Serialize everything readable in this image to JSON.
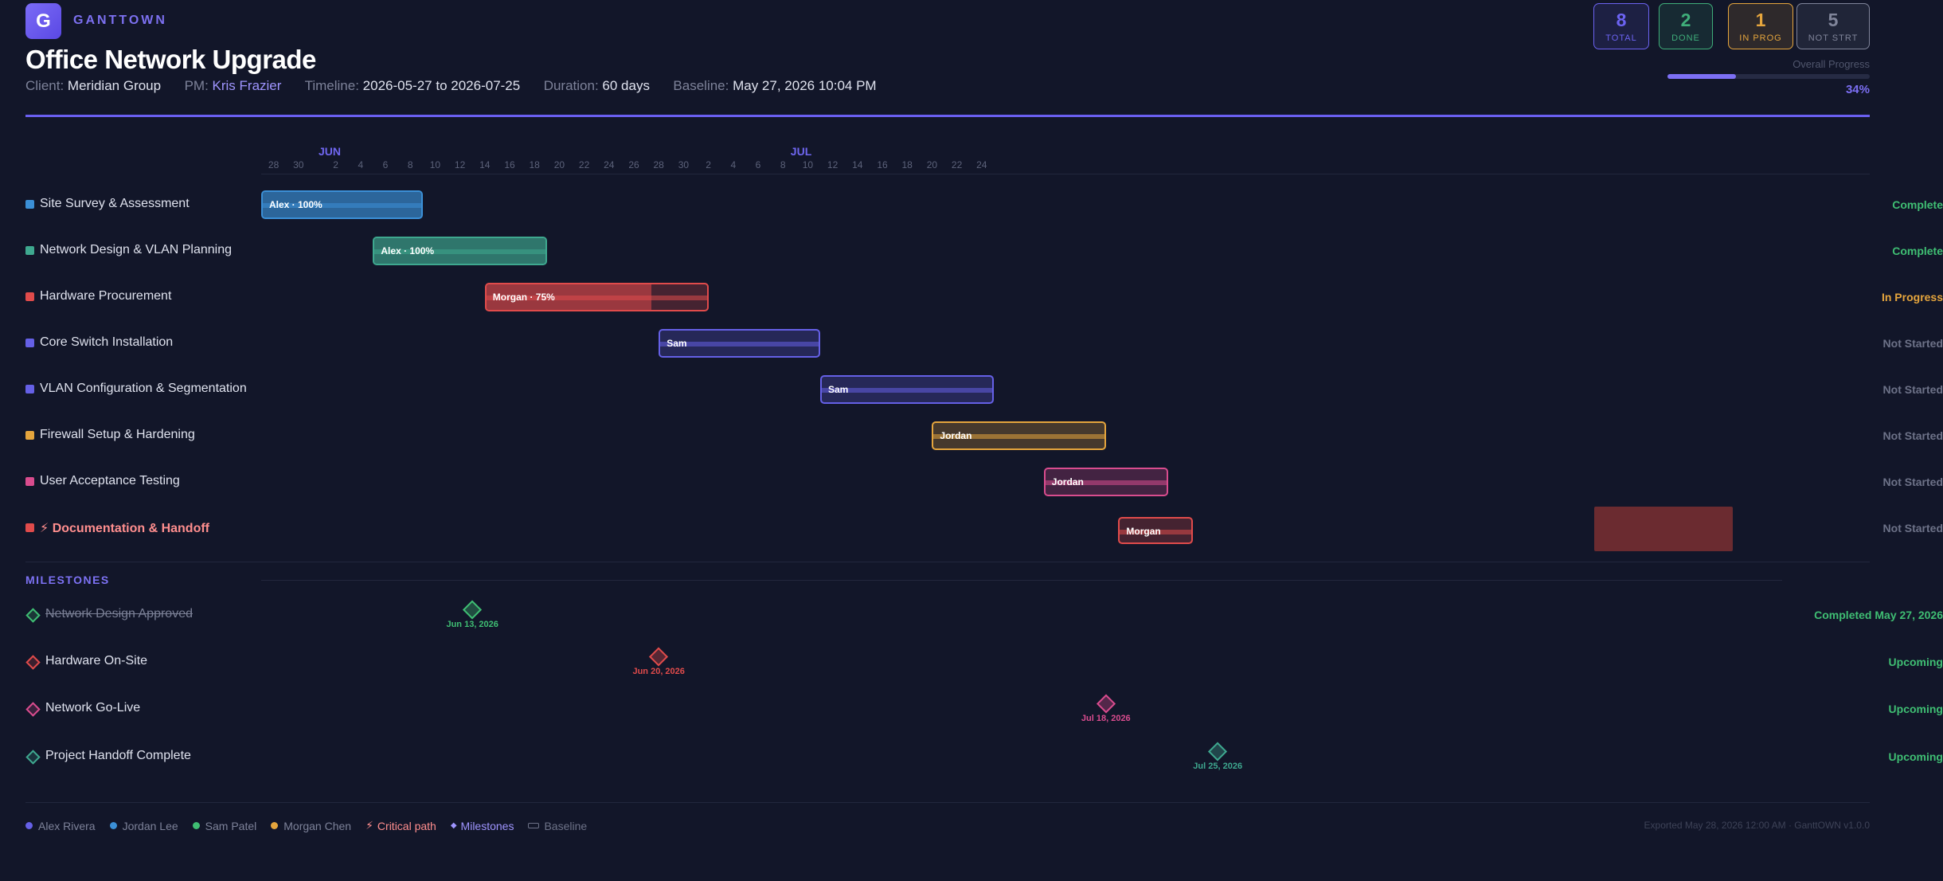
{
  "app": {
    "logo_letter": "G",
    "brand": "GANTTOWN"
  },
  "project": {
    "title": "Office Network Upgrade",
    "client_label": "Client:",
    "client": "Meridian Group",
    "pm_label": "PM:",
    "pm": "Kris Frazier",
    "timeline_label": "Timeline:",
    "timeline": "2026-05-27 to 2026-07-25",
    "duration_label": "Duration:",
    "duration": "60 days",
    "baseline_label": "Baseline:",
    "baseline": "May 27, 2026 10:04 PM"
  },
  "stats": [
    {
      "value": "8",
      "label": "TOTAL",
      "color": "#6c63f2"
    },
    {
      "value": "2",
      "label": "DONE",
      "color": "#3fae7a"
    },
    {
      "value": "1",
      "label": "IN PROG",
      "color": "#e5a53d"
    },
    {
      "value": "5",
      "label": "NOT STRT",
      "color": "#80859a"
    }
  ],
  "progress": {
    "label": "Overall Progress",
    "percent_text": "34%",
    "percent": 34
  },
  "timeline": {
    "months": [
      "JUN",
      "JUL"
    ],
    "ticks": [
      "28",
      "30",
      "2",
      "4",
      "6",
      "8",
      "10",
      "12",
      "14",
      "16",
      "18",
      "20",
      "22",
      "24",
      "26",
      "28",
      "30",
      "2",
      "4",
      "6",
      "8",
      "10",
      "12",
      "14",
      "16",
      "18",
      "20",
      "22",
      "24"
    ]
  },
  "tasks": [
    {
      "name": "Site Survey & Assessment",
      "bar_label": "Alex · 100%",
      "status": "Complete",
      "progress": 100,
      "color": "#3b8fd6",
      "status_color": "#3fbe73",
      "critical": false
    },
    {
      "name": "Network Design & VLAN Planning",
      "bar_label": "Alex · 100%",
      "status": "Complete",
      "progress": 100,
      "color": "#3ea88f",
      "status_color": "#3fbe73",
      "critical": false
    },
    {
      "name": "Hardware Procurement",
      "bar_label": "Morgan · 75%",
      "status": "In Progress",
      "progress": 75,
      "color": "#e04b4b",
      "status_color": "#e5a53d",
      "critical": false
    },
    {
      "name": "Core Switch Installation",
      "bar_label": "Sam",
      "status": "Not Started",
      "progress": 0,
      "color": "#6560e6",
      "status_color": "#6d7288",
      "critical": false
    },
    {
      "name": "VLAN Configuration & Segmentation",
      "bar_label": "Sam",
      "status": "Not Started",
      "progress": 0,
      "color": "#6560e6",
      "status_color": "#6d7288",
      "critical": false
    },
    {
      "name": "Firewall Setup & Hardening",
      "bar_label": "Jordan",
      "status": "Not Started",
      "progress": 0,
      "color": "#e5a53d",
      "status_color": "#6d7288",
      "critical": false
    },
    {
      "name": "User Acceptance Testing",
      "bar_label": "Jordan",
      "status": "Not Started",
      "progress": 0,
      "color": "#d94c8e",
      "status_color": "#6d7288",
      "critical": false
    },
    {
      "name": "Documentation & Handoff",
      "bar_label": "Morgan",
      "status": "Not Started",
      "progress": 0,
      "color": "#e04b4b",
      "status_color": "#6d7288",
      "critical": true
    }
  ],
  "milestones_heading": "MILESTONES",
  "milestones": [
    {
      "name": "Network Design Approved",
      "date": "Jun 13, 2026",
      "status": "Completed May 27, 2026",
      "color": "#3fbe73",
      "done": true
    },
    {
      "name": "Hardware On-Site",
      "date": "Jun 20, 2026",
      "status": "Upcoming",
      "color": "#e04b4b",
      "done": false
    },
    {
      "name": "Network Go-Live",
      "date": "Jul 18, 2026",
      "status": "Upcoming",
      "color": "#d94c8e",
      "done": false
    },
    {
      "name": "Project Handoff Complete",
      "date": "Jul 25, 2026",
      "status": "Upcoming",
      "color": "#3ea88f",
      "done": false
    }
  ],
  "milestone_status_color": "#3fbe73",
  "legend": [
    {
      "label": "Alex Rivera",
      "color": "#6560e6",
      "type": "dot"
    },
    {
      "label": "Jordan Lee",
      "color": "#3b8fd6",
      "type": "dot"
    },
    {
      "label": "Sam Patel",
      "color": "#3fbe73",
      "type": "dot"
    },
    {
      "label": "Morgan Chen",
      "color": "#e5a53d",
      "type": "dot"
    },
    {
      "label": "Critical path",
      "color": "#ff8e8e",
      "type": "bolt"
    },
    {
      "label": "Milestones",
      "color": "#9f95ff",
      "type": "diamond"
    },
    {
      "label": "Baseline",
      "color": "#6d7288",
      "type": "baseline"
    }
  ],
  "footer": {
    "exported": "Exported May 28, 2026 12:00 AM · GanttOWN v1.0.0"
  }
}
